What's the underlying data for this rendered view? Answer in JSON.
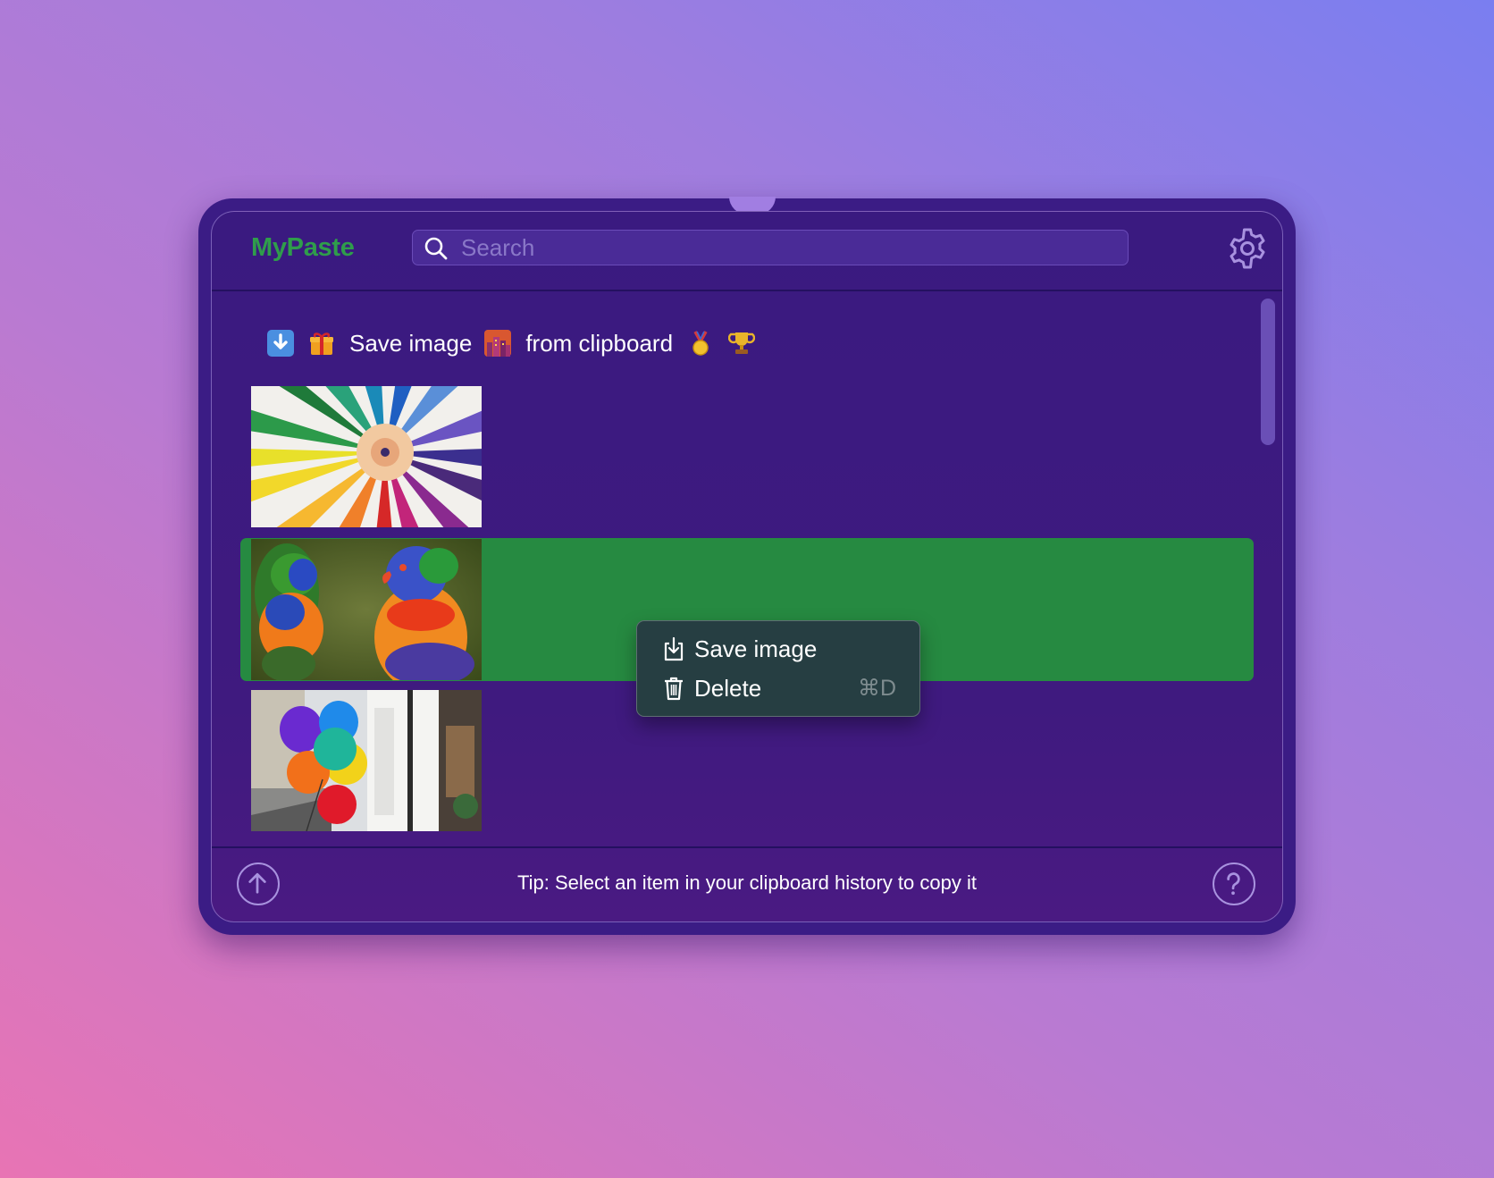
{
  "app": {
    "title": "MyPaste"
  },
  "search": {
    "placeholder": "Search",
    "value": ""
  },
  "history": {
    "text_item": {
      "before": "Save image",
      "after": "from clipboard"
    }
  },
  "context_menu": {
    "items": [
      {
        "label": "Save image",
        "icon": "download-icon",
        "shortcut": ""
      },
      {
        "label": "Delete",
        "icon": "trash-icon",
        "shortcut": "⌘D"
      }
    ]
  },
  "footer": {
    "tip": "Tip: Select an item in your clipboard history to copy it"
  },
  "colors": {
    "accent": "#268a41",
    "title": "#2f9d4b",
    "window": "#3b1c85",
    "menu": "#263e42"
  }
}
